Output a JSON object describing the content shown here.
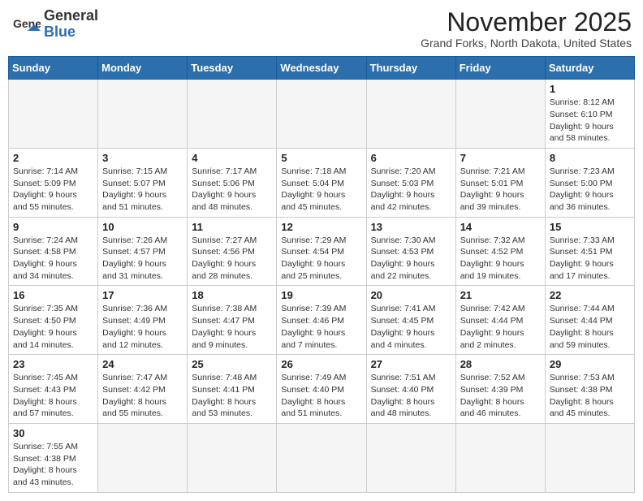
{
  "header": {
    "logo_general": "General",
    "logo_blue": "Blue",
    "title": "November 2025",
    "subtitle": "Grand Forks, North Dakota, United States"
  },
  "weekdays": [
    "Sunday",
    "Monday",
    "Tuesday",
    "Wednesday",
    "Thursday",
    "Friday",
    "Saturday"
  ],
  "weeks": [
    [
      {
        "day": "",
        "info": ""
      },
      {
        "day": "",
        "info": ""
      },
      {
        "day": "",
        "info": ""
      },
      {
        "day": "",
        "info": ""
      },
      {
        "day": "",
        "info": ""
      },
      {
        "day": "",
        "info": ""
      },
      {
        "day": "1",
        "info": "Sunrise: 8:12 AM\nSunset: 6:10 PM\nDaylight: 9 hours\nand 58 minutes."
      }
    ],
    [
      {
        "day": "2",
        "info": "Sunrise: 7:14 AM\nSunset: 5:09 PM\nDaylight: 9 hours\nand 55 minutes."
      },
      {
        "day": "3",
        "info": "Sunrise: 7:15 AM\nSunset: 5:07 PM\nDaylight: 9 hours\nand 51 minutes."
      },
      {
        "day": "4",
        "info": "Sunrise: 7:17 AM\nSunset: 5:06 PM\nDaylight: 9 hours\nand 48 minutes."
      },
      {
        "day": "5",
        "info": "Sunrise: 7:18 AM\nSunset: 5:04 PM\nDaylight: 9 hours\nand 45 minutes."
      },
      {
        "day": "6",
        "info": "Sunrise: 7:20 AM\nSunset: 5:03 PM\nDaylight: 9 hours\nand 42 minutes."
      },
      {
        "day": "7",
        "info": "Sunrise: 7:21 AM\nSunset: 5:01 PM\nDaylight: 9 hours\nand 39 minutes."
      },
      {
        "day": "8",
        "info": "Sunrise: 7:23 AM\nSunset: 5:00 PM\nDaylight: 9 hours\nand 36 minutes."
      }
    ],
    [
      {
        "day": "9",
        "info": "Sunrise: 7:24 AM\nSunset: 4:58 PM\nDaylight: 9 hours\nand 34 minutes."
      },
      {
        "day": "10",
        "info": "Sunrise: 7:26 AM\nSunset: 4:57 PM\nDaylight: 9 hours\nand 31 minutes."
      },
      {
        "day": "11",
        "info": "Sunrise: 7:27 AM\nSunset: 4:56 PM\nDaylight: 9 hours\nand 28 minutes."
      },
      {
        "day": "12",
        "info": "Sunrise: 7:29 AM\nSunset: 4:54 PM\nDaylight: 9 hours\nand 25 minutes."
      },
      {
        "day": "13",
        "info": "Sunrise: 7:30 AM\nSunset: 4:53 PM\nDaylight: 9 hours\nand 22 minutes."
      },
      {
        "day": "14",
        "info": "Sunrise: 7:32 AM\nSunset: 4:52 PM\nDaylight: 9 hours\nand 19 minutes."
      },
      {
        "day": "15",
        "info": "Sunrise: 7:33 AM\nSunset: 4:51 PM\nDaylight: 9 hours\nand 17 minutes."
      }
    ],
    [
      {
        "day": "16",
        "info": "Sunrise: 7:35 AM\nSunset: 4:50 PM\nDaylight: 9 hours\nand 14 minutes."
      },
      {
        "day": "17",
        "info": "Sunrise: 7:36 AM\nSunset: 4:49 PM\nDaylight: 9 hours\nand 12 minutes."
      },
      {
        "day": "18",
        "info": "Sunrise: 7:38 AM\nSunset: 4:47 PM\nDaylight: 9 hours\nand 9 minutes."
      },
      {
        "day": "19",
        "info": "Sunrise: 7:39 AM\nSunset: 4:46 PM\nDaylight: 9 hours\nand 7 minutes."
      },
      {
        "day": "20",
        "info": "Sunrise: 7:41 AM\nSunset: 4:45 PM\nDaylight: 9 hours\nand 4 minutes."
      },
      {
        "day": "21",
        "info": "Sunrise: 7:42 AM\nSunset: 4:44 PM\nDaylight: 9 hours\nand 2 minutes."
      },
      {
        "day": "22",
        "info": "Sunrise: 7:44 AM\nSunset: 4:44 PM\nDaylight: 8 hours\nand 59 minutes."
      }
    ],
    [
      {
        "day": "23",
        "info": "Sunrise: 7:45 AM\nSunset: 4:43 PM\nDaylight: 8 hours\nand 57 minutes."
      },
      {
        "day": "24",
        "info": "Sunrise: 7:47 AM\nSunset: 4:42 PM\nDaylight: 8 hours\nand 55 minutes."
      },
      {
        "day": "25",
        "info": "Sunrise: 7:48 AM\nSunset: 4:41 PM\nDaylight: 8 hours\nand 53 minutes."
      },
      {
        "day": "26",
        "info": "Sunrise: 7:49 AM\nSunset: 4:40 PM\nDaylight: 8 hours\nand 51 minutes."
      },
      {
        "day": "27",
        "info": "Sunrise: 7:51 AM\nSunset: 4:40 PM\nDaylight: 8 hours\nand 48 minutes."
      },
      {
        "day": "28",
        "info": "Sunrise: 7:52 AM\nSunset: 4:39 PM\nDaylight: 8 hours\nand 46 minutes."
      },
      {
        "day": "29",
        "info": "Sunrise: 7:53 AM\nSunset: 4:38 PM\nDaylight: 8 hours\nand 45 minutes."
      }
    ],
    [
      {
        "day": "30",
        "info": "Sunrise: 7:55 AM\nSunset: 4:38 PM\nDaylight: 8 hours\nand 43 minutes."
      },
      {
        "day": "",
        "info": ""
      },
      {
        "day": "",
        "info": ""
      },
      {
        "day": "",
        "info": ""
      },
      {
        "day": "",
        "info": ""
      },
      {
        "day": "",
        "info": ""
      },
      {
        "day": "",
        "info": ""
      }
    ]
  ]
}
